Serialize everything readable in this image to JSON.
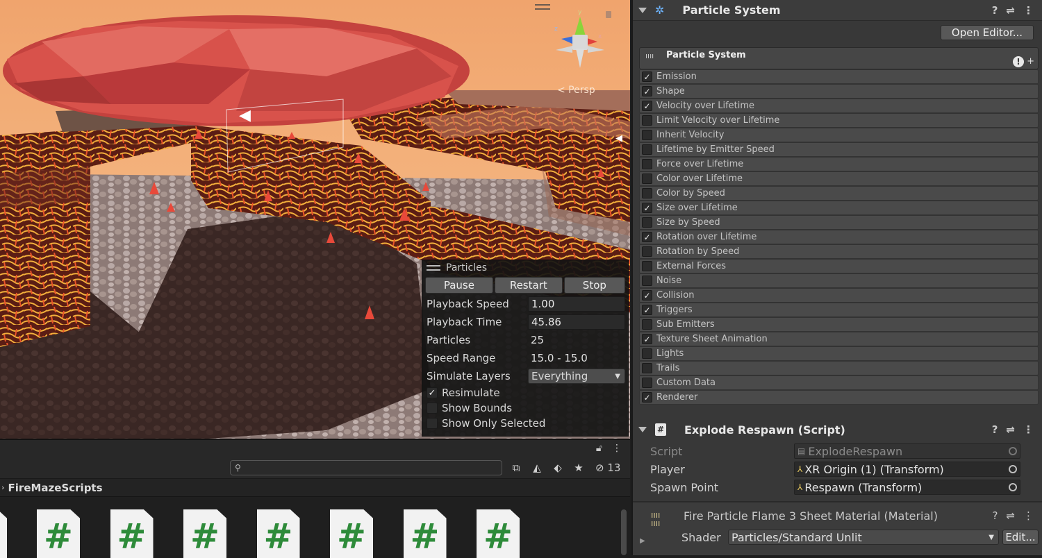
{
  "scene": {
    "persp_label": "< Persp",
    "gizmo_axes": {
      "y": "y",
      "x": "x",
      "z": "z"
    }
  },
  "particles_overlay": {
    "title": "Particles",
    "buttons": {
      "pause": "Pause",
      "restart": "Restart",
      "stop": "Stop"
    },
    "playback_speed": {
      "label": "Playback Speed",
      "value": "1.00"
    },
    "playback_time": {
      "label": "Playback Time",
      "value": "45.86"
    },
    "particles": {
      "label": "Particles",
      "value": "25"
    },
    "speed_range": {
      "label": "Speed Range",
      "value": "15.0 - 15.0"
    },
    "simulate_layers": {
      "label": "Simulate Layers",
      "value": "Everything"
    },
    "resimulate": {
      "label": "Resimulate",
      "checked": true
    },
    "show_bounds": {
      "label": "Show Bounds",
      "checked": false
    },
    "show_only_selected": {
      "label": "Show Only Selected",
      "checked": false
    }
  },
  "inspector": {
    "particle_system": {
      "title": "Particle System",
      "open_editor": "Open Editor...",
      "main_module": "Particle System",
      "modules": [
        {
          "label": "Emission",
          "checked": true
        },
        {
          "label": "Shape",
          "checked": true
        },
        {
          "label": "Velocity over Lifetime",
          "checked": true
        },
        {
          "label": "Limit Velocity over Lifetime",
          "checked": false
        },
        {
          "label": "Inherit Velocity",
          "checked": false
        },
        {
          "label": "Lifetime by Emitter Speed",
          "checked": false
        },
        {
          "label": "Force over Lifetime",
          "checked": false
        },
        {
          "label": "Color over Lifetime",
          "checked": false
        },
        {
          "label": "Color by Speed",
          "checked": false
        },
        {
          "label": "Size over Lifetime",
          "checked": true
        },
        {
          "label": "Size by Speed",
          "checked": false
        },
        {
          "label": "Rotation over Lifetime",
          "checked": true
        },
        {
          "label": "Rotation by Speed",
          "checked": false
        },
        {
          "label": "External Forces",
          "checked": false
        },
        {
          "label": "Noise",
          "checked": false
        },
        {
          "label": "Collision",
          "checked": true
        },
        {
          "label": "Triggers",
          "checked": true
        },
        {
          "label": "Sub Emitters",
          "checked": false
        },
        {
          "label": "Texture Sheet Animation",
          "checked": true
        },
        {
          "label": "Lights",
          "checked": false
        },
        {
          "label": "Trails",
          "checked": false
        },
        {
          "label": "Custom Data",
          "checked": false
        },
        {
          "label": "Renderer",
          "checked": true
        }
      ]
    },
    "explode_respawn": {
      "title": "Explode Respawn (Script)",
      "script_label": "Script",
      "script_value": "ExplodeRespawn",
      "player_label": "Player",
      "player_value": "XR Origin (1) (Transform)",
      "spawn_label": "Spawn Point",
      "spawn_value": "Respawn (Transform)"
    },
    "material": {
      "title": "Fire Particle Flame 3 Sheet Material (Material)",
      "shader_label": "Shader",
      "shader_value": "Particles/Standard Unlit",
      "edit_button": "Edit..."
    }
  },
  "project": {
    "hidden_count": "13",
    "breadcrumb": "FireMazeScripts",
    "file_glyph": "#",
    "file_count": 8
  }
}
